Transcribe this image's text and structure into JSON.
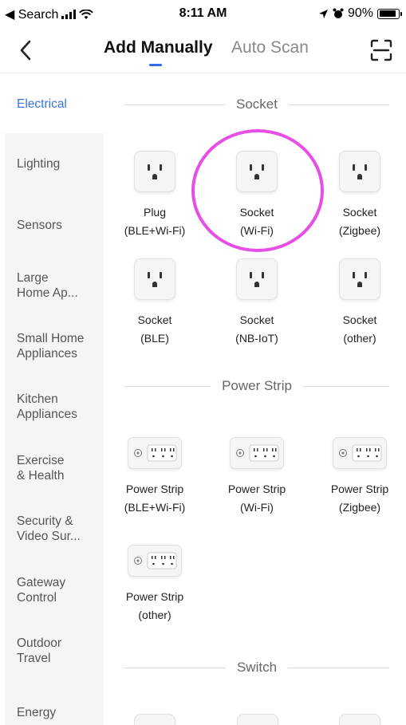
{
  "status_bar": {
    "back_app": "◀ Search",
    "time": "8:11 AM",
    "battery_percent_label": "90%",
    "battery_level": 0.9
  },
  "nav": {
    "tabs": [
      {
        "label": "Add Manually",
        "active": true
      },
      {
        "label": "Auto Scan",
        "active": false
      }
    ]
  },
  "sidebar": {
    "items": [
      {
        "label": "Electrical",
        "active": true
      },
      {
        "label": "Lighting"
      },
      {
        "label": "Sensors"
      },
      {
        "label": "Large\nHome Ap..."
      },
      {
        "label": "Small Home\nAppliances"
      },
      {
        "label": "Kitchen\nAppliances"
      },
      {
        "label": "Exercise\n& Health"
      },
      {
        "label": "Security &\nVideo Sur..."
      },
      {
        "label": "Gateway\nControl"
      },
      {
        "label": "Outdoor\nTravel"
      },
      {
        "label": "Energy"
      }
    ]
  },
  "sections": {
    "socket": {
      "title": "Socket",
      "devices": [
        {
          "name": "Plug",
          "sub": "(BLE+Wi-Fi)"
        },
        {
          "name": "Socket",
          "sub": "(Wi-Fi)"
        },
        {
          "name": "Socket",
          "sub": "(Zigbee)"
        },
        {
          "name": "Socket",
          "sub": "(BLE)"
        },
        {
          "name": "Socket",
          "sub": "(NB-IoT)"
        },
        {
          "name": "Socket",
          "sub": "(other)"
        }
      ]
    },
    "power_strip": {
      "title": "Power Strip",
      "devices": [
        {
          "name": "Power Strip",
          "sub": "(BLE+Wi-Fi)"
        },
        {
          "name": "Power Strip",
          "sub": "(Wi-Fi)"
        },
        {
          "name": "Power Strip",
          "sub": "(Zigbee)"
        },
        {
          "name": "Power Strip",
          "sub": "(other)"
        }
      ]
    },
    "switch": {
      "title": "Switch"
    }
  },
  "colors": {
    "accent": "#2f6bec",
    "sidebar_active_text": "#3a73e0",
    "highlight": "#e64ee6"
  },
  "icons": [
    "back-chevron-icon",
    "scan-icon",
    "socket-icon",
    "power-strip-icon",
    "signal-icon",
    "wifi-icon",
    "location-icon",
    "alarm-icon",
    "battery-icon"
  ]
}
